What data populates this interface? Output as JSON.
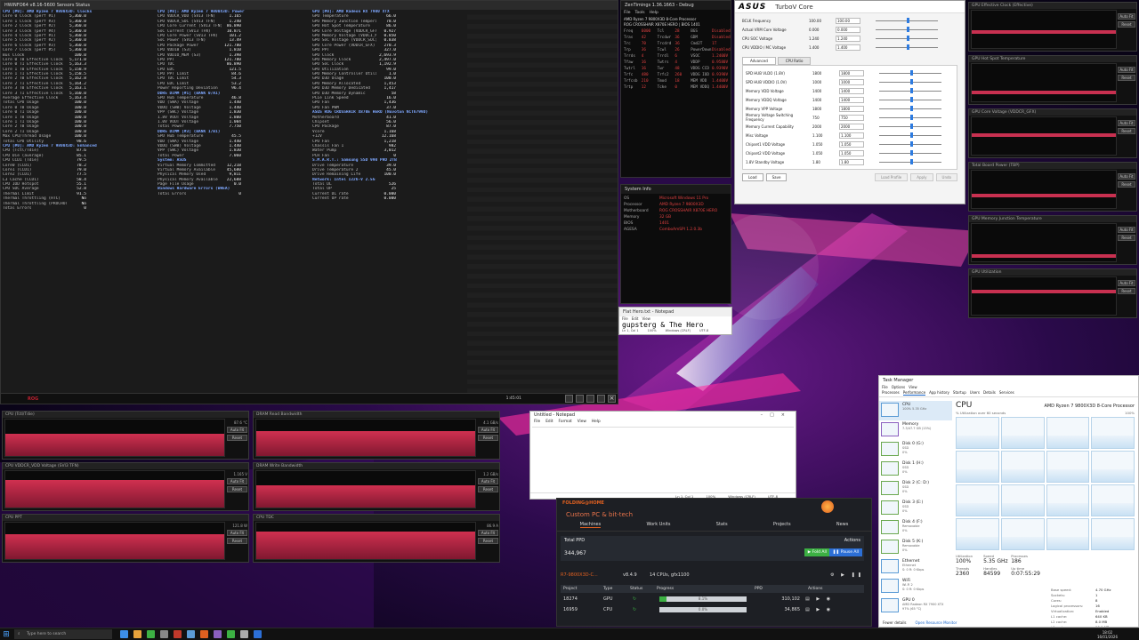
{
  "colors": {
    "accent_blue": "#2848a8",
    "graph_red": "#c83050",
    "fah_orange": "#e06020",
    "fah_green": "#3cb043",
    "fah_blue": "#2c6fd6"
  },
  "hwinfo": {
    "title": "HWiNFO64 v8.16-5600 Sensors Status",
    "columns": [
      "Sensor",
      "Current",
      "Minimum",
      "Maximum",
      "Average"
    ],
    "col1": [
      {
        "g": true,
        "n": "CPU [#0]: AMD Ryzen 7 9800X3D: Clocks"
      },
      {
        "n": "Core 0 Clock (perf #1)",
        "v": "5,360.0"
      },
      {
        "n": "Core 1 Clock (perf #3)",
        "v": "5,360.0"
      },
      {
        "n": "Core 2 Clock (perf #2)",
        "v": "5,360.0"
      },
      {
        "n": "Core 3 Clock (perf #4)",
        "v": "5,360.0"
      },
      {
        "n": "Core 4 Clock (perf #1)",
        "v": "5,360.0"
      },
      {
        "n": "Core 5 Clock (perf #2)",
        "v": "5,360.0"
      },
      {
        "n": "Core 6 Clock (perf #3)",
        "v": "5,360.0"
      },
      {
        "n": "Core 7 Clock (perf #5)",
        "v": "5,360.0"
      },
      {
        "n": "Bus Clock",
        "v": "100.0"
      },
      {
        "n": "Core 0 T0 Effective Clock",
        "v": "5,171.0"
      },
      {
        "n": "Core 0 T1 Effective Clock",
        "v": "5,163.3"
      },
      {
        "n": "Core 1 T0 Effective Clock",
        "v": "5,158.9"
      },
      {
        "n": "Core 1 T1 Effective Clock",
        "v": "5,158.5"
      },
      {
        "n": "Core 2 T0 Effective Clock",
        "v": "5,162.8"
      },
      {
        "n": "Core 2 T1 Effective Clock",
        "v": "5,164.2"
      },
      {
        "n": "Core 3 T0 Effective Clock",
        "v": "5,163.1"
      },
      {
        "n": "Core 3 T1 Effective Clock",
        "v": "5,160.0"
      },
      {
        "n": "Average Effective Clock",
        "v": "5,163.4"
      },
      {
        "n": "Total CPU Usage",
        "v": "100.0"
      },
      {
        "n": "Core 0 T0 Usage",
        "v": "100.0"
      },
      {
        "n": "Core 0 T1 Usage",
        "v": "100.0"
      },
      {
        "n": "Core 1 T0 Usage",
        "v": "100.0"
      },
      {
        "n": "Core 1 T1 Usage",
        "v": "100.0"
      },
      {
        "n": "Core 2 T0 Usage",
        "v": "100.0"
      },
      {
        "n": "Core 2 T1 Usage",
        "v": "100.0"
      },
      {
        "n": "Max CPU/Thread Usage",
        "v": "100.0"
      },
      {
        "n": "Total CPU Utility",
        "v": "98.6"
      },
      {
        "g": true,
        "n": "CPU [#0]: AMD Ryzen 7 9800X3D: Enhanced"
      },
      {
        "n": "CPU (Tctl/Tdie)",
        "v": "87.6"
      },
      {
        "n": "CPU Die (average)",
        "v": "85.1"
      },
      {
        "n": "CPU CCD1 (Tdie)",
        "v": "79.5"
      },
      {
        "n": "Core0 (CCD1)",
        "v": "78.2"
      },
      {
        "n": "Core1 (CCD1)",
        "v": "79.0"
      },
      {
        "n": "Core2 (CCD1)",
        "v": "77.5"
      },
      {
        "n": "L3 Cache (CCD1)",
        "v": "58.4"
      },
      {
        "n": "CPU IOD Hotspot",
        "v": "55.1"
      },
      {
        "n": "CPU SOC Average",
        "v": "52.8"
      },
      {
        "n": "Thermal Limit",
        "v": "91.5"
      },
      {
        "n": "Thermal Throttling (HTC)",
        "v": "No"
      },
      {
        "n": "Thermal Throttling (PROCHOT CPU)",
        "v": "No"
      },
      {
        "n": "Total Errors",
        "v": "0"
      }
    ],
    "col2": [
      {
        "g": true,
        "n": "CPU [#0]: AMD Ryzen 7 9800X3D: Power"
      },
      {
        "n": "CPU VDDCR_VDD (SVI3 TFN)",
        "v": "1.165"
      },
      {
        "n": "CPU VDDCR_SOC (SVI3 TFN)",
        "v": "1.240"
      },
      {
        "n": "CPU Core Current (SVI3 TFN)",
        "v": "86.890"
      },
      {
        "n": "SoC Current (SVI3 TFN)",
        "v": "10.871"
      },
      {
        "n": "CPU Core Power (SVI3 TFN)",
        "v": "101.2"
      },
      {
        "n": "SoC Power (SVI3 TFN)",
        "v": "13.49"
      },
      {
        "n": "CPU Package Power",
        "v": "121.780"
      },
      {
        "n": "CPU VDD18 (S3)",
        "v": "1.810"
      },
      {
        "n": "CPU VDDIO_MEM (S3)",
        "v": "1.398"
      },
      {
        "n": "CPU PPT",
        "v": "121.780"
      },
      {
        "n": "CPU TDC",
        "v": "86.890"
      },
      {
        "n": "CPU EDC",
        "v": "121.5"
      },
      {
        "n": "CPU PPT Limit",
        "v": "84.6"
      },
      {
        "n": "CPU TDC Limit",
        "v": "54.3"
      },
      {
        "n": "CPU EDC Limit",
        "v": "53.2"
      },
      {
        "n": "Power Reporting Deviation",
        "v": "96.4"
      },
      {
        "g": true,
        "n": "DDR5 DIMM [#1] (BANK 0/A1)"
      },
      {
        "n": "SPD Hub Temperature",
        "v": "46.8"
      },
      {
        "n": "VDD (SWA) Voltage",
        "v": "1.440"
      },
      {
        "n": "VDDQ (SWB) Voltage",
        "v": "1.440"
      },
      {
        "n": "VPP (SWC) Voltage",
        "v": "1.830"
      },
      {
        "n": "1.8V VOUT Voltage",
        "v": "1.800"
      },
      {
        "n": "1.0V VOUT Voltage",
        "v": "1.004"
      },
      {
        "n": "Total Power",
        "v": "7.750"
      },
      {
        "g": true,
        "n": "DDR5 DIMM [#3] (BANK 1/B1)"
      },
      {
        "n": "SPD Hub Temperature",
        "v": "45.5"
      },
      {
        "n": "VDD (SWA) Voltage",
        "v": "1.440"
      },
      {
        "n": "VDDQ (SWB) Voltage",
        "v": "1.440"
      },
      {
        "n": "VPP (SWC) Voltage",
        "v": "1.830"
      },
      {
        "n": "Total Power",
        "v": "7.060"
      },
      {
        "g": true,
        "n": "System: ASUS"
      },
      {
        "n": "Virtual Memory Committed",
        "v": "12,218"
      },
      {
        "n": "Virtual Memory Available",
        "v": "45,680"
      },
      {
        "n": "Physical Memory Used",
        "v": "9,811"
      },
      {
        "n": "Physical Memory Available",
        "v": "22,688"
      },
      {
        "n": "Page File Usage",
        "v": "0.0"
      },
      {
        "g": true,
        "n": "Windows Hardware Errors (WHEA)"
      },
      {
        "n": "Total Errors",
        "v": "0"
      }
    ],
    "col3": [
      {
        "g": true,
        "n": "GPU [#0]: AMD Radeon RX 7900 XTX"
      },
      {
        "n": "GPU Temperature",
        "v": "66.0"
      },
      {
        "n": "GPU Memory Junction Temperature",
        "v": "78.0"
      },
      {
        "n": "GPU Hot Spot Temperature",
        "v": "86.0"
      },
      {
        "n": "GPU Core Voltage (VDDCR_GFX)",
        "v": "0.927"
      },
      {
        "n": "GPU Memory Voltage (VDDCI_MEM)",
        "v": "0.850"
      },
      {
        "n": "GPU SoC Voltage (VDDCR_SOC)",
        "v": "0.838"
      },
      {
        "n": "GPU Core Power (VDDCR_GFX)",
        "v": "270.3"
      },
      {
        "n": "GPU PPT",
        "v": "327.0"
      },
      {
        "n": "GPU Clock",
        "v": "2,693.9"
      },
      {
        "n": "GPU Memory Clock",
        "v": "2,497.0"
      },
      {
        "n": "GPU SoC Clock",
        "v": "1,192.9"
      },
      {
        "n": "GPU Utilization",
        "v": "99.0"
      },
      {
        "n": "GPU Memory Controller Utilization",
        "v": "1.0"
      },
      {
        "n": "GPU D3D Usage",
        "v": "100.0"
      },
      {
        "n": "GPU Memory Allocated",
        "v": "1,453"
      },
      {
        "n": "GPU D3D Memory Dedicated",
        "v": "1,417"
      },
      {
        "n": "GPU D3D Memory Dynamic",
        "v": "58"
      },
      {
        "n": "PCIe Link Speed",
        "v": "16.0"
      },
      {
        "n": "GPU Fan",
        "v": "1,436"
      },
      {
        "n": "GPU Fan PWM",
        "v": "37.0"
      },
      {
        "g": true,
        "n": "ASUS ROG CROSSHAIR X870E HERO (Nuvoton NCT6799D)"
      },
      {
        "n": "Motherboard",
        "v": "41.0"
      },
      {
        "n": "Chipset",
        "v": "56.0"
      },
      {
        "n": "CPU Package",
        "v": "87.0"
      },
      {
        "n": "Vcore",
        "v": "1.168"
      },
      {
        "n": "+12V",
        "v": "12.168"
      },
      {
        "n": "CPU Fan",
        "v": "1,218"
      },
      {
        "n": "Chassis Fan 1",
        "v": "982"
      },
      {
        "n": "Water Pump",
        "v": "3,012"
      },
      {
        "n": "PCH Fan",
        "v": "0"
      },
      {
        "g": true,
        "n": "S.M.A.R.T.: Samsung SSD 990 PRO 2TB"
      },
      {
        "n": "Drive Temperature",
        "v": "39.0"
      },
      {
        "n": "Drive Temperature 2",
        "v": "45.0"
      },
      {
        "n": "Drive Remaining Life",
        "v": "100.0"
      },
      {
        "g": true,
        "n": "Network: Intel I226-V 2.5G"
      },
      {
        "n": "Total DL",
        "v": "526"
      },
      {
        "n": "Total UP",
        "v": "25"
      },
      {
        "n": "Current DL rate",
        "v": "0.000"
      },
      {
        "n": "Current UP rate",
        "v": "0.000"
      }
    ],
    "timer": "1:45:01"
  },
  "graphs": [
    {
      "title": "CPU (Tctl/Tdie)",
      "val": "87.6 °C",
      "btn1": "Auto Fit",
      "btn2": "Reset"
    },
    {
      "title": "DRAM Read Bandwidth",
      "val": "4.1 GB/s",
      "btn1": "Auto Fit",
      "btn2": "Reset"
    },
    {
      "title": "CPU VDDCR_VDD Voltage (SVI3 TFN)",
      "val": "1.165 V",
      "btn1": "Auto Fit",
      "btn2": "Reset"
    },
    {
      "title": "DRAM Write Bandwidth",
      "val": "1.2 GB/s",
      "btn1": "Auto Fit",
      "btn2": "Reset"
    },
    {
      "title": "CPU PPT",
      "val": "121.8 W",
      "btn1": "Auto Fit",
      "btn2": "Reset"
    },
    {
      "title": "CPU TDC",
      "val": "86.9 A",
      "btn1": "Auto Fit",
      "btn2": "Reset"
    }
  ],
  "right_graphs": [
    {
      "title": "GPU Effective Clock (Effective)"
    },
    {
      "title": "GPU Hot Spot Temperature"
    },
    {
      "title": "GPU Core Voltage (VDDCR_GFX)"
    },
    {
      "title": "Total Board Power (TBP)"
    },
    {
      "title": "GPU Memory Junction Temperature"
    },
    {
      "title": "GPU Utilization"
    }
  ],
  "zentimings": {
    "title": "ZenTimings 1.36.1663 - Debug",
    "menu": [
      "File",
      "Tools",
      "Help"
    ],
    "cpu": "AMD Ryzen 7 9800X3D 8-Core Processor",
    "board": "ROG CROSSHAIR X870E HERO | BIOS 1401",
    "rows": [
      [
        "Freq",
        "6000",
        "Tcl",
        "28",
        "BGS",
        "Disabled"
      ],
      [
        "Tras",
        "42",
        "Trcdwr",
        "36",
        "GDM",
        "Disabled"
      ],
      [
        "Trc",
        "70",
        "Trcdrd",
        "36",
        "Cmd2T",
        "1T"
      ],
      [
        "Trp",
        "36",
        "Tcwl",
        "26",
        "PowerDown",
        "Disabled"
      ],
      [
        "Trrds",
        "4",
        "Trrdl",
        "6",
        "VSOC",
        "1.2400V"
      ],
      [
        "Tfaw",
        "16",
        "Twtrs",
        "4",
        "VDDP",
        "0.9580V"
      ],
      [
        "Twtrl",
        "16",
        "Twr",
        "48",
        "VDDG CCD",
        "0.9390V"
      ],
      [
        "Trfc",
        "480",
        "Trfc2",
        "260",
        "VDDG IOD",
        "0.9390V"
      ],
      [
        "Trfcsb",
        "210",
        "Tmod",
        "18",
        "MEM VDD",
        "1.4400V"
      ],
      [
        "Trtp",
        "12",
        "Tcke",
        "0",
        "MEM VDDQ",
        "1.4400V"
      ]
    ]
  },
  "system_info": {
    "title": "System Info",
    "rows": [
      [
        "OS",
        "Microsoft Windows 11 Pro"
      ],
      [
        "Processor",
        "AMD Ryzen 7 9800X3D"
      ],
      [
        "Motherboard",
        "ROG CROSSHAIR X870E HERO"
      ],
      [
        "Memory",
        "32 GB"
      ],
      [
        "BIOS",
        "1401"
      ],
      [
        "AGESA",
        "ComboAmSPI 1.2.0.3b"
      ]
    ]
  },
  "turbo": {
    "brand": "ASUS",
    "title": "TurboV Core",
    "rows": [
      [
        "BCLK Frequency",
        "100.00",
        "100.00"
      ],
      [
        "Actual VRM Core Voltage",
        "0.000",
        "0.000"
      ],
      [
        "CPU SOC Voltage",
        "1.240",
        "1.240"
      ],
      [
        "CPU VDDIO / MC Voltage",
        "1.400",
        "1.400"
      ]
    ],
    "tabs": [
      "Advanced",
      "CPU Ratio"
    ],
    "adv_rows": [
      [
        "SPD HUB VLDO (1.8V)",
        "1800",
        "1800"
      ],
      [
        "SPD HUB VDDIO (1.0V)",
        "1000",
        "1000"
      ],
      [
        "Memory VDD Voltage",
        "1400",
        "1400"
      ],
      [
        "Memory VDDQ Voltage",
        "1400",
        "1400"
      ],
      [
        "Memory VPP Voltage",
        "1800",
        "1800"
      ],
      [
        "Memory Voltage Switching Frequency",
        "750",
        "750"
      ],
      [
        "Memory Current Capability",
        "2000",
        "2000"
      ],
      [
        "Misc Voltage",
        "1.100",
        "1.100"
      ],
      [
        "Chipset1 VDD Voltage",
        "1.050",
        "1.050"
      ],
      [
        "Chipset2 VDD Voltage",
        "1.050",
        "1.050"
      ],
      [
        "1.8V Standby Voltage",
        "1.80",
        "1.80"
      ]
    ],
    "buttons": [
      "Load",
      "Save",
      "Load Profile",
      "Apply",
      "Undo"
    ]
  },
  "notepad_small": {
    "title": "Flat Hero.txt - Notepad",
    "menu": [
      "File",
      "Edit",
      "View"
    ],
    "text": "gupsterg & The Hero",
    "status": [
      "Ln 1, Col 1",
      "100%",
      "Windows (CRLF)",
      "UTF-8"
    ]
  },
  "notepad": {
    "title": "Untitled - Notepad",
    "menu": [
      "File",
      "Edit",
      "Format",
      "View",
      "Help"
    ],
    "status": [
      "Ln 1, Col 1",
      "100%",
      "Windows (CRLF)",
      "UTF-8"
    ]
  },
  "fah": {
    "brand": "FOLDING@HOME",
    "subtitle": "Custom PC & bit-tech",
    "tabs": [
      "Machines",
      "Work Units",
      "Stats",
      "Projects",
      "News"
    ],
    "total_ppd_label": "Total PPD",
    "actions_label": "Actions",
    "total_ppd": "344,967",
    "fold_all": "Fold All",
    "pause_all": "Pause All",
    "machine_name": "R7-9800X3D-C...",
    "version": "v8.4.9",
    "cpus": "14 CPUs, gfx1100",
    "columns": [
      "Project",
      "Type",
      "Status",
      "Progress",
      "PPD",
      "Actions"
    ],
    "units": [
      {
        "project": "18274",
        "type": "GPU",
        "progress": "8.1%",
        "fill": 0.081,
        "ppd": "310,102"
      },
      {
        "project": "16959",
        "type": "CPU",
        "progress": "0.0%",
        "fill": 0.0,
        "ppd": "34,865"
      }
    ]
  },
  "taskmgr": {
    "title": "Task Manager",
    "menu": [
      "File",
      "Options",
      "View"
    ],
    "tabs": [
      "Processes",
      "Performance",
      "App history",
      "Startup",
      "Users",
      "Details",
      "Services"
    ],
    "items": [
      {
        "name": "CPU",
        "sub": "100% 5.35 GHz"
      },
      {
        "name": "Memory",
        "sub": "7.3/47.7 GB (15%)"
      },
      {
        "name": "Disk 0 (G:)",
        "sub": "SSD\n0%"
      },
      {
        "name": "Disk 1 (H:)",
        "sub": "SSD\n0%"
      },
      {
        "name": "Disk 2 (C: D:)",
        "sub": "SSD\n0%"
      },
      {
        "name": "Disk 3 (E:)",
        "sub": "SSD\n0%"
      },
      {
        "name": "Disk 4 (F:)",
        "sub": "Removable\n0%"
      },
      {
        "name": "Disk 5 (K:)",
        "sub": "Removable\n0%"
      },
      {
        "name": "Ethernet",
        "sub": "Ethernet\nS: 0 R: 0 Kbps"
      },
      {
        "name": "WiFi",
        "sub": "Wi-Fi 2\nS: 0 R: 0 Kbps"
      },
      {
        "name": "GPU 0",
        "sub": "AMD Radeon RX 7900 XTX\n97% (65 °C)"
      }
    ],
    "heading": "CPU",
    "cpu_name": "AMD Ryzen 7 9800X3D 8-Core Processor",
    "graph_label": "% Utilization over 60 seconds",
    "graph_max": "100%",
    "stats": [
      {
        "label": "Utilization",
        "value": "100%"
      },
      {
        "label": "Speed",
        "value": "5.35 GHz"
      },
      {
        "label": "Processes",
        "value": "186"
      },
      {
        "label": "Threads",
        "value": "2360"
      },
      {
        "label": "Handles",
        "value": "84599"
      },
      {
        "label": "Up time",
        "value": "0:07:55:29"
      }
    ],
    "details": [
      [
        "Base speed:",
        "4.70 GHz"
      ],
      [
        "Sockets:",
        "1"
      ],
      [
        "Cores:",
        "8"
      ],
      [
        "Logical processors:",
        "16"
      ],
      [
        "Virtualization:",
        "Enabled"
      ],
      [
        "L1 cache:",
        "640 KB"
      ],
      [
        "L2 cache:",
        "8.0 MB"
      ],
      [
        "L3 cache:",
        "96.0 MB"
      ]
    ],
    "fewer_details": "Fewer details",
    "open_resmon": "Open Resource Monitor"
  },
  "taskbar": {
    "search_placeholder": "Type here to search",
    "time": "18:02",
    "date": "16/01/2026"
  }
}
